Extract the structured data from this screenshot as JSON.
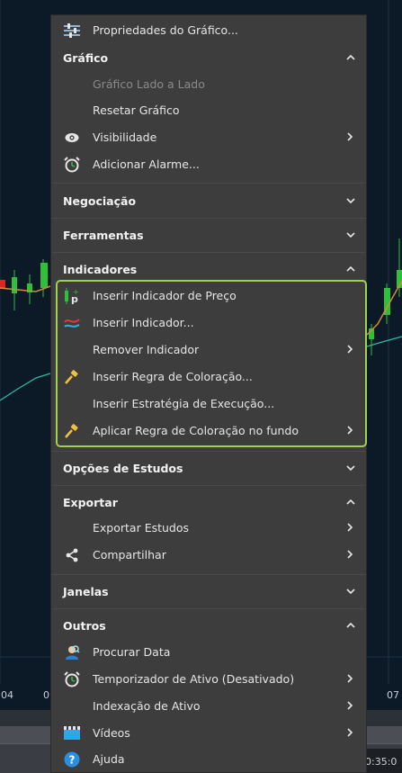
{
  "chart_axis": {
    "label_left": "04",
    "label_mid": "0",
    "label_right": "07",
    "time_readout": "0:35:0"
  },
  "menu": {
    "top_item": {
      "label": "Propriedades do Gráfico...",
      "icon": "chart-properties-icon"
    },
    "sections": {
      "grafico": {
        "title": "Gráfico",
        "expanded": true,
        "items": [
          {
            "label": "Gráfico Lado a Lado",
            "disabled": true
          },
          {
            "label": "Resetar Gráfico"
          },
          {
            "label": "Visibilidade",
            "icon": "eye-icon",
            "submenu": true
          },
          {
            "label": "Adicionar Alarme...",
            "icon": "alarm-clock-icon"
          }
        ]
      },
      "negociacao": {
        "title": "Negociação",
        "expanded": false
      },
      "ferramentas": {
        "title": "Ferramentas",
        "expanded": false
      },
      "indicadores": {
        "title": "Indicadores",
        "expanded": true,
        "items": [
          {
            "label": "Inserir Indicador de Preço",
            "icon": "price-indicator-icon"
          },
          {
            "label": "Inserir Indicador...",
            "icon": "indicator-icon"
          },
          {
            "label": "Remover Indicador",
            "submenu": true
          },
          {
            "label": "Inserir Regra de Coloração...",
            "icon": "paint-brush-icon"
          },
          {
            "label": "Inserir Estratégia de Execução..."
          },
          {
            "label": "Aplicar Regra de Coloração no fundo",
            "icon": "paint-brush-icon",
            "submenu": true
          }
        ]
      },
      "opcoes": {
        "title": "Opções de Estudos",
        "expanded": false
      },
      "exportar": {
        "title": "Exportar",
        "expanded": true,
        "items": [
          {
            "label": "Exportar Estudos",
            "submenu": true
          },
          {
            "label": "Compartilhar",
            "icon": "share-icon",
            "submenu": true
          }
        ]
      },
      "janelas": {
        "title": "Janelas",
        "expanded": false
      },
      "outros": {
        "title": "Outros",
        "expanded": true,
        "items": [
          {
            "label": "Procurar Data",
            "icon": "search-user-icon"
          },
          {
            "label": "Temporizador de Ativo (Desativado)",
            "icon": "alarm-clock-icon",
            "submenu": true
          },
          {
            "label": "Indexação de Ativo",
            "submenu": true
          },
          {
            "label": "Vídeos",
            "icon": "video-icon",
            "submenu": true
          },
          {
            "label": "Ajuda",
            "icon": "help-icon"
          }
        ]
      }
    }
  },
  "colors": {
    "menu_bg": "#3d3d3d",
    "highlight_border": "#9fd24c",
    "chart_bg": "#0c1a28"
  }
}
